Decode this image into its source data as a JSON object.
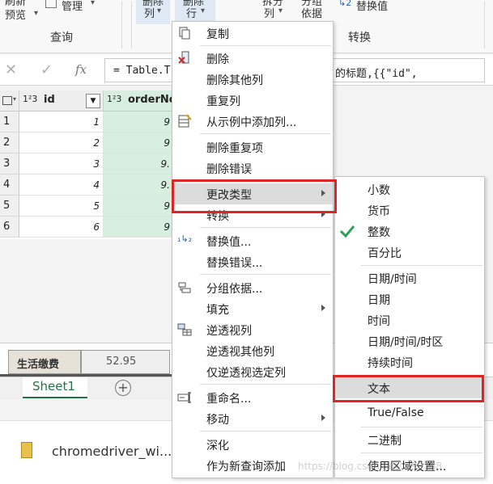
{
  "ribbon": {
    "items": [
      {
        "text": "刷新"
      },
      {
        "text": "预览"
      },
      {
        "text": "管理"
      },
      {
        "text": "删除"
      },
      {
        "text": "列"
      },
      {
        "text": "删除"
      },
      {
        "text": "行"
      },
      {
        "text": "拆分"
      },
      {
        "text": "列"
      },
      {
        "text": "分组"
      },
      {
        "text": "依据"
      },
      {
        "text": "替换值"
      }
    ],
    "group_query": "查询",
    "group_transform": "转换"
  },
  "formula_bar": {
    "cancel_glyph": "✕",
    "confirm_glyph": "✓",
    "fx": "fx",
    "text_left": "= Table.T",
    "text_right": "的标题,{{\"id\","
  },
  "grid": {
    "columns": [
      {
        "type": "1²3",
        "name": "id"
      },
      {
        "type": "1²3",
        "name": "orderNo"
      }
    ],
    "rows": [
      {
        "num": "1",
        "id": "1",
        "order": "9"
      },
      {
        "num": "2",
        "id": "2",
        "order": "9"
      },
      {
        "num": "3",
        "id": "3",
        "order": "9."
      },
      {
        "num": "4",
        "id": "4",
        "order": "9."
      },
      {
        "num": "5",
        "id": "5",
        "order": "9"
      },
      {
        "num": "6",
        "id": "6",
        "order": "9"
      }
    ]
  },
  "excel": {
    "partial_cell_1": "生活缴费",
    "partial_cell_2": "52.95",
    "sheet_tab": "Sheet1",
    "add_sheet": "+"
  },
  "download": {
    "filename": "chromedriver_wi....z"
  },
  "watermark": "https://blog.csdn.net/...90388",
  "context_menu": {
    "items": [
      {
        "label": "复制",
        "icon": "copy-icon"
      },
      {
        "label": "删除",
        "icon": "delete-column-icon"
      },
      {
        "label": "删除其他列"
      },
      {
        "label": "重复列"
      },
      {
        "label": "从示例中添加列...",
        "icon": "column-from-examples-icon"
      },
      {
        "label": "删除重复项"
      },
      {
        "label": "删除错误"
      },
      {
        "label": "更改类型"
      },
      {
        "label": "转换"
      },
      {
        "label": "替换值...",
        "icon": "replace-values-icon"
      },
      {
        "label": "替换错误..."
      },
      {
        "label": "分组依据...",
        "icon": "group-by-icon"
      },
      {
        "label": "填充"
      },
      {
        "label": "逆透视列",
        "icon": "unpivot-icon"
      },
      {
        "label": "逆透视其他列"
      },
      {
        "label": "仅逆透视选定列"
      },
      {
        "label": "重命名...",
        "icon": "rename-icon"
      },
      {
        "label": "移动"
      },
      {
        "label": "深化"
      },
      {
        "label": "作为新查询添加"
      }
    ]
  },
  "type_submenu": {
    "items": [
      {
        "label": "小数"
      },
      {
        "label": "货币"
      },
      {
        "label": "整数",
        "checked": true
      },
      {
        "label": "百分比"
      },
      {
        "label": "日期/时间"
      },
      {
        "label": "日期"
      },
      {
        "label": "时间"
      },
      {
        "label": "日期/时间/时区"
      },
      {
        "label": "持续时间"
      },
      {
        "label": "文本"
      },
      {
        "label": "True/False"
      },
      {
        "label": "二进制"
      },
      {
        "label": "使用区域设置..."
      }
    ]
  },
  "colors": {
    "highlight_red": "#e02424",
    "check_green": "#2e9f55",
    "grid_green": "#d8efe0"
  }
}
